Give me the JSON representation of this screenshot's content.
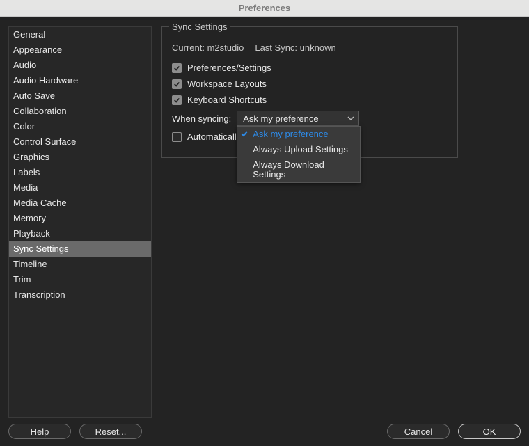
{
  "window": {
    "title": "Preferences"
  },
  "sidebar": {
    "items": [
      {
        "label": "General",
        "selected": false
      },
      {
        "label": "Appearance",
        "selected": false
      },
      {
        "label": "Audio",
        "selected": false
      },
      {
        "label": "Audio Hardware",
        "selected": false
      },
      {
        "label": "Auto Save",
        "selected": false
      },
      {
        "label": "Collaboration",
        "selected": false
      },
      {
        "label": "Color",
        "selected": false
      },
      {
        "label": "Control Surface",
        "selected": false
      },
      {
        "label": "Graphics",
        "selected": false
      },
      {
        "label": "Labels",
        "selected": false
      },
      {
        "label": "Media",
        "selected": false
      },
      {
        "label": "Media Cache",
        "selected": false
      },
      {
        "label": "Memory",
        "selected": false
      },
      {
        "label": "Playback",
        "selected": false
      },
      {
        "label": "Sync Settings",
        "selected": true
      },
      {
        "label": "Timeline",
        "selected": false
      },
      {
        "label": "Trim",
        "selected": false
      },
      {
        "label": "Transcription",
        "selected": false
      }
    ]
  },
  "panel": {
    "legend": "Sync Settings",
    "current_label": "Current:",
    "current_value": "m2studio",
    "last_sync_label": "Last Sync:",
    "last_sync_value": "unknown",
    "checkboxes": [
      {
        "label": "Preferences/Settings",
        "checked": true
      },
      {
        "label": "Workspace Layouts",
        "checked": true
      },
      {
        "label": "Keyboard Shortcuts",
        "checked": true
      }
    ],
    "when_syncing_label": "When syncing:",
    "dropdown": {
      "selected": "Ask my preference",
      "open": true,
      "options": [
        {
          "label": "Ask my preference",
          "selected": true
        },
        {
          "label": "Always Upload Settings",
          "selected": false
        },
        {
          "label": "Always Download Settings",
          "selected": false
        }
      ]
    },
    "auto_clear": {
      "label_visible": "Automaticall",
      "checked": false
    }
  },
  "footer": {
    "help": "Help",
    "reset": "Reset...",
    "cancel": "Cancel",
    "ok": "OK"
  }
}
